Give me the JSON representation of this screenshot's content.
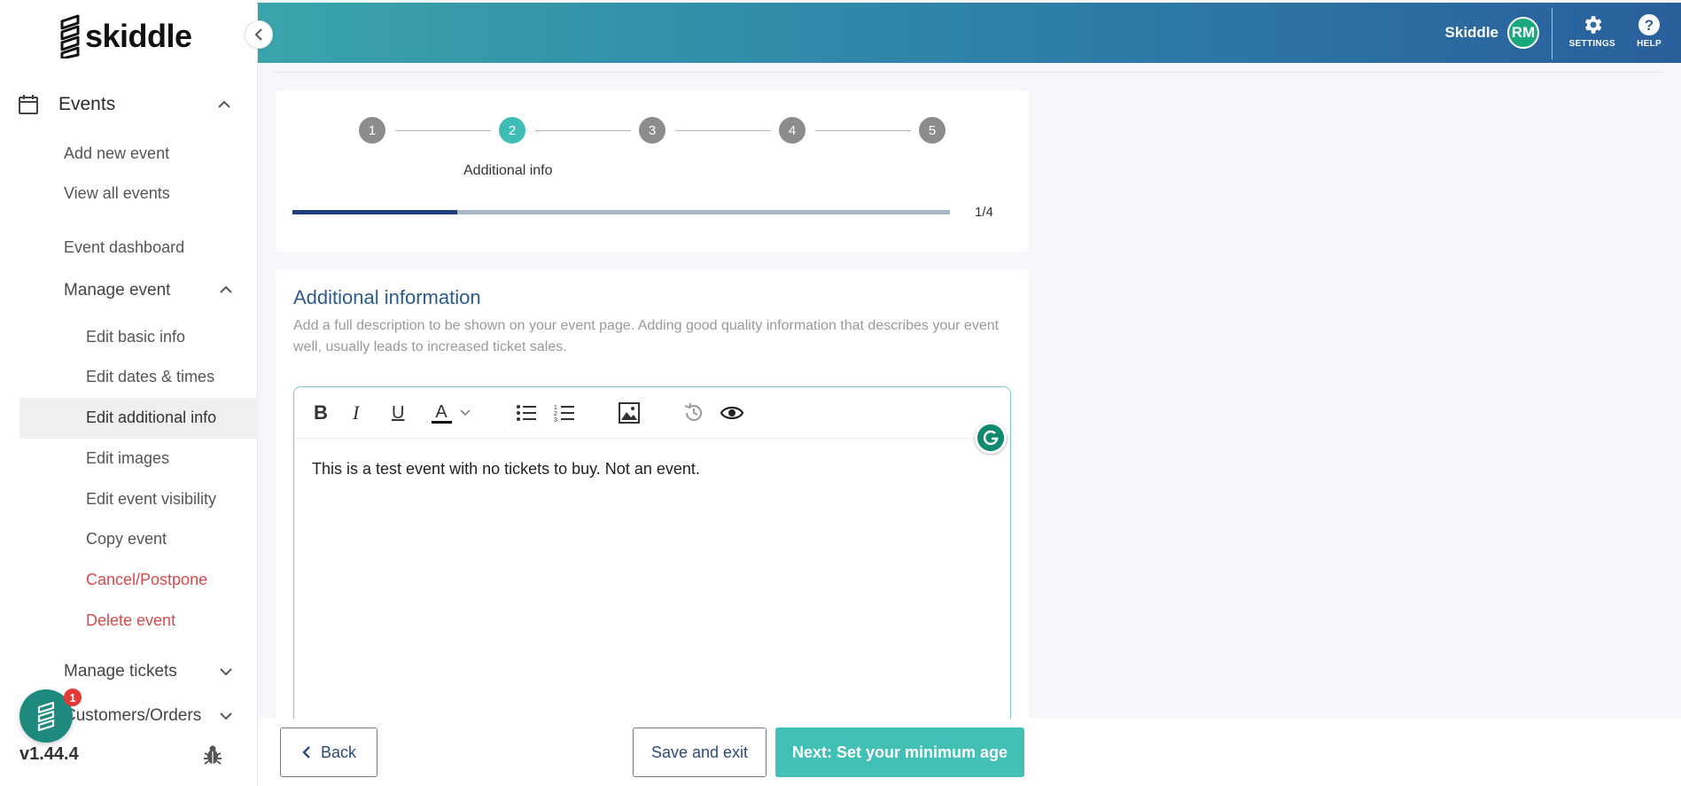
{
  "brand": {
    "logo_text": "skiddle"
  },
  "header": {
    "user_name": "Skiddle",
    "avatar_initials": "RM",
    "settings_label": "SETTINGS",
    "help_label": "HELP",
    "gradient_colors": [
      "#3aa4ab",
      "#2a5f9c"
    ]
  },
  "sidebar": {
    "events_label": "Events",
    "items": {
      "add_new_event": "Add new event",
      "view_all_events": "View all events",
      "event_dashboard": "Event dashboard",
      "manage_event": "Manage event"
    },
    "manage_event_items": [
      {
        "label": "Edit basic info"
      },
      {
        "label": "Edit dates & times"
      },
      {
        "label": "Edit additional info",
        "active": true
      },
      {
        "label": "Edit images"
      },
      {
        "label": "Edit event visibility"
      },
      {
        "label": "Copy event"
      },
      {
        "label": "Cancel/Postpone",
        "danger": true
      },
      {
        "label": "Delete event",
        "danger": true
      }
    ],
    "manage_tickets": "Manage tickets",
    "customers_orders": "Customers/Orders",
    "notification_count": "1",
    "version": "v1.44.4"
  },
  "stepper": {
    "steps": [
      "1",
      "2",
      "3",
      "4",
      "5"
    ],
    "active_step": 2,
    "active_label": "Additional info",
    "progress_fraction": 0.25,
    "progress_text": "1/4"
  },
  "additional_info": {
    "title": "Additional information",
    "description": "Add a full description to be shown on your event page. Adding good quality information that describes your event well, usually leads to increased ticket sales.",
    "editor_content": "This is a test event with no tickets to buy. Not an event.",
    "toolbar": {
      "bold": "B",
      "italic": "I",
      "underline": "U"
    }
  },
  "footer": {
    "back_label": "Back",
    "save_label": "Save and exit",
    "next_label": "Next: Set your minimum age"
  },
  "colors": {
    "accent": "#43c0b6",
    "progress": "#1f3f7a",
    "danger": "#d84a4a",
    "title": "#2b5b8f"
  }
}
